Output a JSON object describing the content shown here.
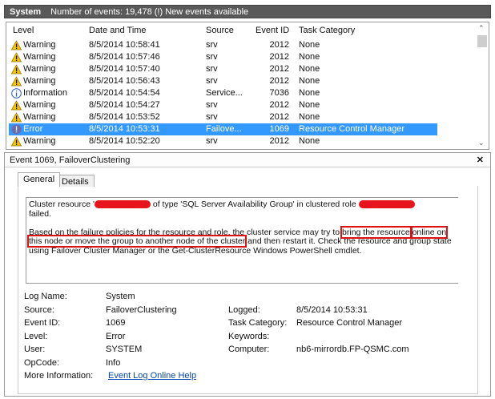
{
  "header": {
    "title": "System",
    "info": "Number of events: 19,478 (!) New events available"
  },
  "columns": [
    "Level",
    "Date and Time",
    "Source",
    "Event ID",
    "Task Category"
  ],
  "rows": [
    {
      "level": "Warning",
      "icon": "warning-icon",
      "date": "8/5/2014 10:58:41",
      "source": "srv",
      "id": "2012",
      "task": "None"
    },
    {
      "level": "Warning",
      "icon": "warning-icon",
      "date": "8/5/2014 10:57:46",
      "source": "srv",
      "id": "2012",
      "task": "None"
    },
    {
      "level": "Warning",
      "icon": "warning-icon",
      "date": "8/5/2014 10:57:40",
      "source": "srv",
      "id": "2012",
      "task": "None"
    },
    {
      "level": "Warning",
      "icon": "warning-icon",
      "date": "8/5/2014 10:56:43",
      "source": "srv",
      "id": "2012",
      "task": "None"
    },
    {
      "level": "Information",
      "icon": "info-icon",
      "date": "8/5/2014 10:54:54",
      "source": "Service...",
      "id": "7036",
      "task": "None"
    },
    {
      "level": "Warning",
      "icon": "warning-icon",
      "date": "8/5/2014 10:54:27",
      "source": "srv",
      "id": "2012",
      "task": "None"
    },
    {
      "level": "Warning",
      "icon": "warning-icon",
      "date": "8/5/2014 10:53:52",
      "source": "srv",
      "id": "2012",
      "task": "None"
    },
    {
      "level": "Error",
      "icon": "error-icon",
      "date": "8/5/2014 10:53:31",
      "source": "Failove...",
      "id": "1069",
      "task": "Resource Control Manager",
      "selected": true
    },
    {
      "level": "Warning",
      "icon": "warning-icon",
      "date": "8/5/2014 10:52:20",
      "source": "srv",
      "id": "2012",
      "task": "None"
    }
  ],
  "detail": {
    "title": "Event 1069, FailoverClustering",
    "tabs": [
      "General",
      "Details"
    ],
    "msg_a": "Cluster resource '",
    "msg_b": " of type 'SQL Server Availability Group' in clustered role ",
    "msg_c": "failed.",
    "msg2_a": "Based on the failure policies for the resource and role, the cluster service may try to ",
    "msg2_hl1": "bring the resource",
    "msg2_hl2": "online on this node or move the group to another node of the cluster",
    "msg2_b": " and then restart it.  Check the resource and group state using Failover Cluster Manager or the Get-ClusterResource Windows PowerShell cmdlet.",
    "fields": {
      "log_name_label": "Log Name:",
      "log_name": "System",
      "source_label": "Source:",
      "source": "FailoverClustering",
      "logged_label": "Logged:",
      "logged": "8/5/2014 10:53:31",
      "event_id_label": "Event ID:",
      "event_id": "1069",
      "task_label": "Task Category:",
      "task": "Resource Control Manager",
      "level_label": "Level:",
      "level": "Error",
      "keywords_label": "Keywords:",
      "user_label": "User:",
      "user": "SYSTEM",
      "computer_label": "Computer:",
      "computer": "nb6-mirrordb.FP-QSMC.com",
      "opcode_label": "OpCode:",
      "opcode": "Info",
      "more_label": "More Information:",
      "more_link": "Event Log Online Help"
    }
  }
}
